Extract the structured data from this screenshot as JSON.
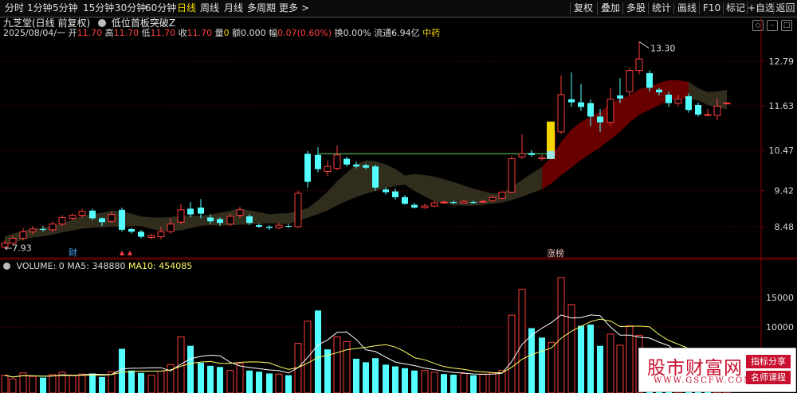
{
  "toolbar": {
    "periods": [
      "分时",
      "1分钟",
      "5分钟",
      "15分钟",
      "30分钟",
      "60分钟",
      "日线",
      "周线",
      "月线",
      "多周期",
      "更多 >"
    ],
    "active_period": "日线",
    "right_buttons": [
      "复权",
      "叠加",
      "多股",
      "统计",
      "画线",
      "F10",
      "标记",
      "+自选",
      "返回"
    ]
  },
  "header": {
    "stock_name": "九芝堂(日线 前复权)",
    "indicator_name": "低位首板突破Z",
    "date": "2025/08/04/一",
    "open_label": "开",
    "open": "11.70",
    "high_label": "高",
    "high": "11.70",
    "low_label": "低",
    "low": "11.70",
    "close_label": "收",
    "close": "11.70",
    "vol_label": "量",
    "vol": "0",
    "amount_label": "额",
    "amount": "0.000",
    "change_label": "幅",
    "change": "0.07(0.60%)",
    "turnover_label": "换",
    "turnover": "0.00%",
    "float_label": "流通",
    "float": "6.94亿",
    "sector": "中药"
  },
  "price_axis": {
    "ticks": [
      "12.79",
      "11.63",
      "10.47",
      "9.42",
      "8.48"
    ],
    "high_marker": "13.30",
    "low_marker": "7.93"
  },
  "markers": {
    "cai": "财",
    "zhangbang": "涨榜"
  },
  "volume_panel": {
    "label": "VOLUME: 0",
    "ma5_label": "MA5: 348880",
    "ma10_label": "MA10: 454085",
    "ticks": [
      "15000",
      "10000"
    ]
  },
  "watermark": {
    "title": "股市财富网",
    "url": "WWW.GSCFW.COM",
    "tag1": "指标分享",
    "tag2": "名师课程"
  },
  "colors": {
    "up": "#ff3d3d",
    "down": "#54ffff",
    "active": "#f3d500",
    "ma10": "#ffff66",
    "ma5": "#ffffff",
    "band_bear": "#3a3522",
    "band_bull": "#7a0000"
  }
}
